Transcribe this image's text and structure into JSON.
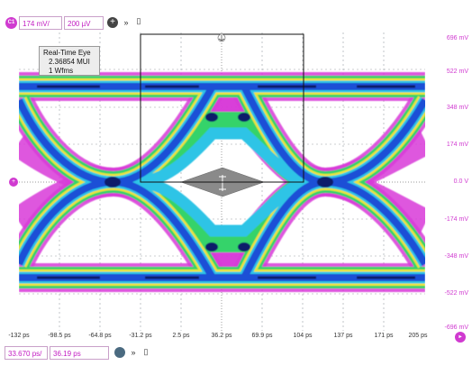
{
  "vertical_controls": {
    "channel_badge": "C1",
    "scale": "174 mV/",
    "offset": "200 µV"
  },
  "horizontal_controls": {
    "scale": "33.670 ps/",
    "position": "36.19 ps"
  },
  "measurement": {
    "title": "Real-Time Eye",
    "line1": "2.36854 MUI",
    "line2": "1 Wfms"
  },
  "y_axis_labels": [
    "696 mV",
    "522 mV",
    "348 mV",
    "174 mV",
    "0.0 V",
    "-174 mV",
    "-348 mV",
    "-522 mV",
    "-696 mV"
  ],
  "x_axis_labels": [
    "-132 ps",
    "-98.5 ps",
    "-64.8 ps",
    "-31.2 ps",
    "2.5 ps",
    "36.2 ps",
    "69.9 ps",
    "104 ps",
    "137 ps",
    "171 ps",
    "205 ps"
  ],
  "colors": {
    "accent": "#d03ad0",
    "eye_core": "#0a1b8a",
    "eye_mid": "#2cc9e8",
    "eye_edge": "#f0e020",
    "mask": "#8a8a8a"
  }
}
